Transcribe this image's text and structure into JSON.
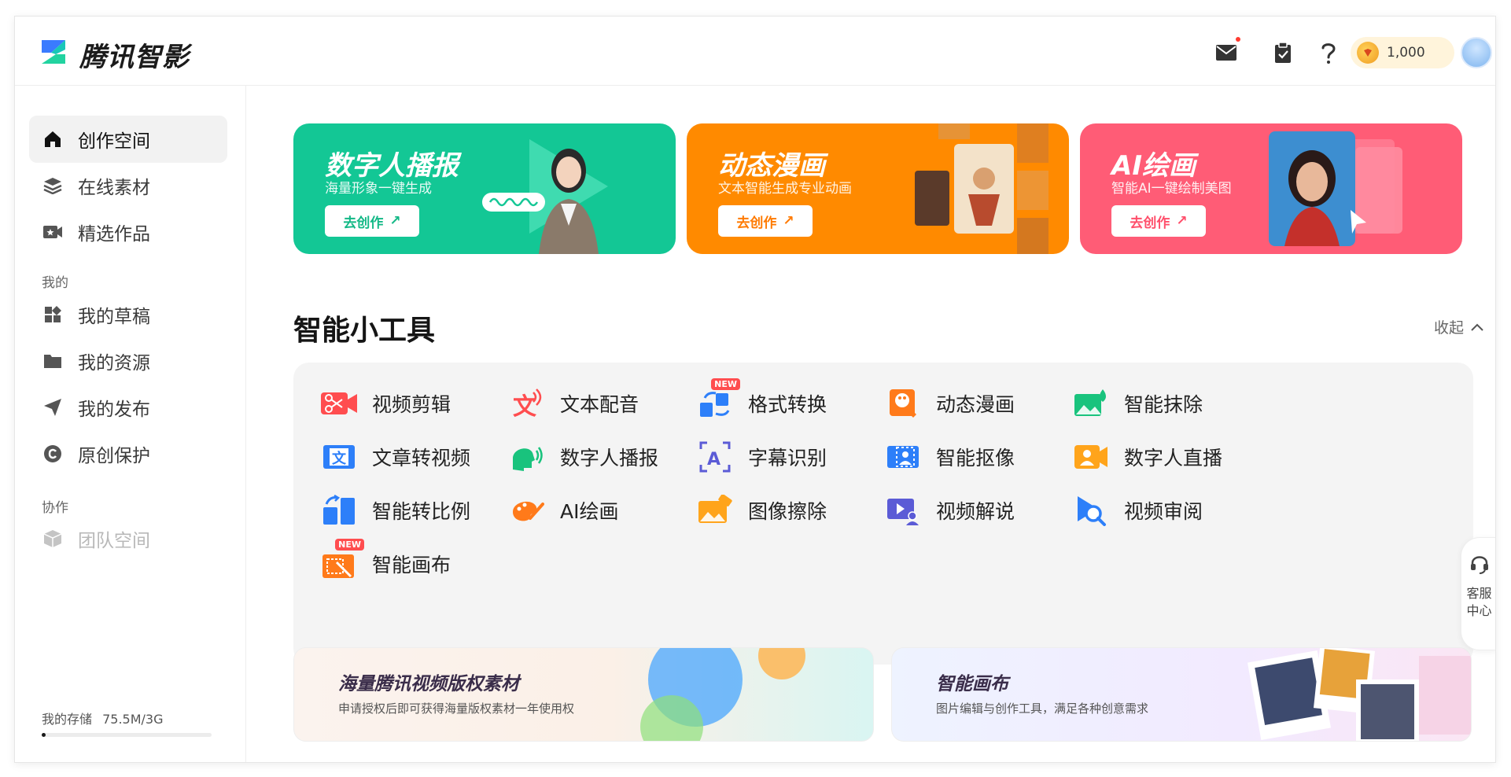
{
  "header": {
    "brand": "腾讯智影",
    "coins": "1,000",
    "icons": [
      "mail-icon",
      "clipboard-icon",
      "help-icon",
      "coin-icon"
    ]
  },
  "sidebar": {
    "items": [
      {
        "label": "创作空间",
        "icon": "home-icon"
      },
      {
        "label": "在线素材",
        "icon": "layers-icon"
      },
      {
        "label": "精选作品",
        "icon": "video-star-icon"
      }
    ],
    "section_mine": "我的",
    "mine_items": [
      {
        "label": "我的草稿",
        "icon": "grid-icon"
      },
      {
        "label": "我的资源",
        "icon": "folder-icon"
      },
      {
        "label": "我的发布",
        "icon": "send-icon"
      },
      {
        "label": "原创保护",
        "icon": "copyright-icon"
      }
    ],
    "section_collab": "协作",
    "collab_items": [
      {
        "label": "团队空间",
        "icon": "cube-icon"
      }
    ],
    "storage_label": "我的存储",
    "storage_value": "75.5M/3G",
    "storage_fraction": 0.025
  },
  "banners": [
    {
      "title": "数字人播报",
      "subtitle": "海量形象一键生成",
      "button": "去创作",
      "color": "#13c795"
    },
    {
      "title": "动态漫画",
      "subtitle": "文本智能生成专业动画",
      "button": "去创作",
      "color": "#ff8a00"
    },
    {
      "title": "AI绘画",
      "subtitle": "智能AI一键绘制美图",
      "button": "去创作",
      "color": "#ff5c76"
    }
  ],
  "tools": {
    "title": "智能小工具",
    "collapse": "收起",
    "new_tag": "NEW",
    "items": [
      {
        "label": "视频剪辑"
      },
      {
        "label": "文本配音"
      },
      {
        "label": "格式转换"
      },
      {
        "label": "动态漫画"
      },
      {
        "label": "智能抹除"
      },
      {
        "label": "文章转视频"
      },
      {
        "label": "数字人播报"
      },
      {
        "label": "字幕识别"
      },
      {
        "label": "智能抠像"
      },
      {
        "label": "数字人直播"
      },
      {
        "label": "智能转比例"
      },
      {
        "label": "AI绘画"
      },
      {
        "label": "图像擦除"
      },
      {
        "label": "视频解说"
      },
      {
        "label": "视频审阅"
      },
      {
        "label": "智能画布"
      }
    ]
  },
  "cards": [
    {
      "title": "海量腾讯视频版权素材",
      "subtitle": "申请授权后即可获得海量版权素材一年使用权"
    },
    {
      "title": "智能画布",
      "subtitle": "图片编辑与创作工具，满足各种创意需求"
    }
  ],
  "service": {
    "line1": "客服",
    "line2": "中心"
  }
}
